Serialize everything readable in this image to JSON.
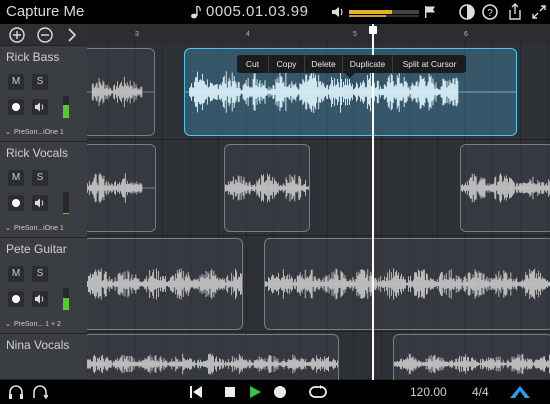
{
  "app": {
    "title": "Capture Me"
  },
  "transport": {
    "position": "0005.01.03.99",
    "tempo": "120.00",
    "time_signature": "4/4",
    "volume_level": 0.62
  },
  "ruler": {
    "marks": [
      "3",
      "4",
      "5",
      "6"
    ]
  },
  "context_menu": {
    "items": [
      "Cut",
      "Copy",
      "Delete",
      "Duplicate",
      "Split at Cursor"
    ]
  },
  "tracks": [
    {
      "name": "Rick Bass",
      "mute": "M",
      "solo": "S",
      "input": "PreSon...iOne 1",
      "meter_level": 0.6
    },
    {
      "name": "Rick Vocals",
      "mute": "M",
      "solo": "S",
      "input": "PreSon...iOne 1",
      "meter_level": 0.05
    },
    {
      "name": "Pete Guitar",
      "mute": "M",
      "solo": "S",
      "input": "PreSon... 1 + 2",
      "meter_level": 0.55
    },
    {
      "name": "Nina Vocals",
      "mute": "",
      "solo": "",
      "input": "",
      "meter_level": 0
    }
  ],
  "colors": {
    "accent": "#48c8ee",
    "meter": "#5cc33a",
    "volume": "#e3b32a",
    "background": "#2e3136"
  },
  "icons": [
    "note-icon",
    "speaker-icon",
    "metronome-icon",
    "help-icon",
    "share-icon",
    "expand-icon",
    "add-icon",
    "remove-icon",
    "chevron-right-icon",
    "record-icon",
    "monitor-icon",
    "headphones-icon",
    "loop-icon",
    "rewind-icon",
    "stop-icon",
    "play-icon",
    "cycle-icon",
    "logo-icon"
  ]
}
